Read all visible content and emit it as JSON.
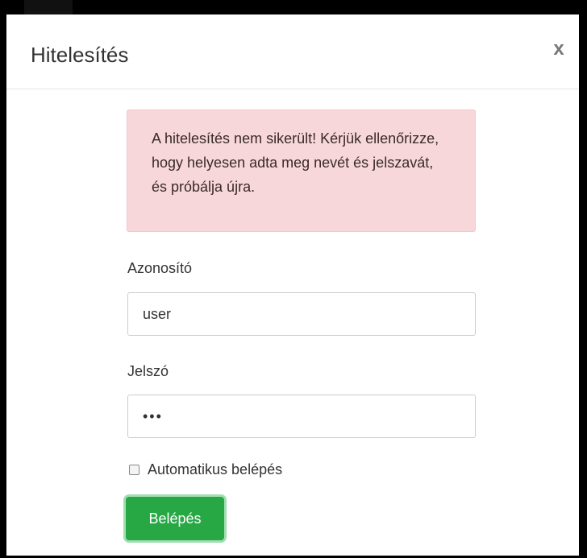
{
  "dialog": {
    "title": "Hitelesítés",
    "close_label": "x"
  },
  "alert": {
    "message": "A hitelesítés nem sikerült! Kérjük ellenőrizze, hogy helyesen adta meg nevét és jelszavát, és próbálja újra."
  },
  "form": {
    "username_label": "Azonosító",
    "username_value": "user",
    "password_label": "Jelszó",
    "password_value": "•••",
    "remember_label": "Automatikus belépés",
    "remember_checked": false,
    "submit_label": "Belépés"
  },
  "colors": {
    "alert_bg": "#f8d7da",
    "submit_bg": "#28a745"
  }
}
